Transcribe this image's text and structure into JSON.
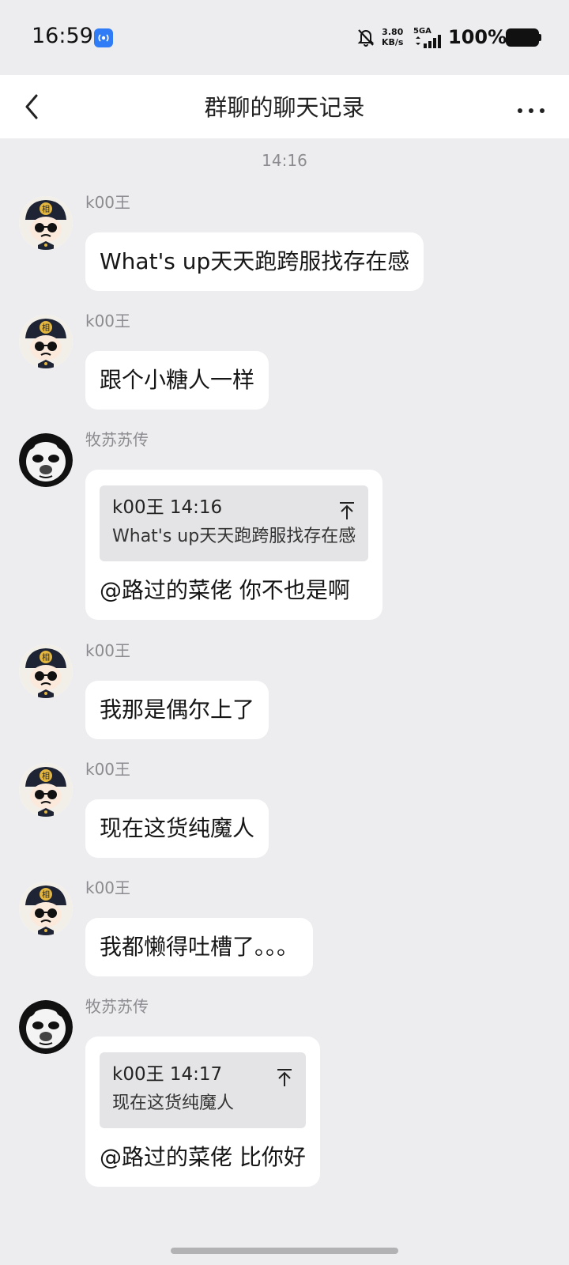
{
  "status_bar": {
    "time": "16:59",
    "speed_value": "3.80",
    "speed_unit": "KB/s",
    "network": "5GA",
    "battery": "100%"
  },
  "nav": {
    "title": "群聊的聊天记录"
  },
  "chat": {
    "timestamp": "14:16",
    "messages": [
      {
        "sender": "k00王",
        "text": "What's up天天跑跨服找存在感"
      },
      {
        "sender": "k00王",
        "text": "跟个小糖人一样"
      },
      {
        "sender": "牧苏苏传",
        "quote_meta": "k00王 14:16",
        "quote_text": "What's up天天跑跨服找存在感",
        "text": "@路过的菜佬 你不也是啊"
      },
      {
        "sender": "k00王",
        "text": "我那是偶尔上了"
      },
      {
        "sender": "k00王",
        "text": "现在这货纯魔人"
      },
      {
        "sender": "k00王",
        "text": "我都懒得吐槽了。。。"
      },
      {
        "sender": "牧苏苏传",
        "quote_meta": "k00王 14:17",
        "quote_text": "现在这货纯魔人",
        "text": "@路过的菜佬 比你好"
      }
    ]
  },
  "colors": {
    "background": "#ededf0",
    "bubble": "#ffffff",
    "quote": "#e4e4e6",
    "meta_text": "#8c8c90",
    "hotspot_blue": "#2f7cf6"
  }
}
